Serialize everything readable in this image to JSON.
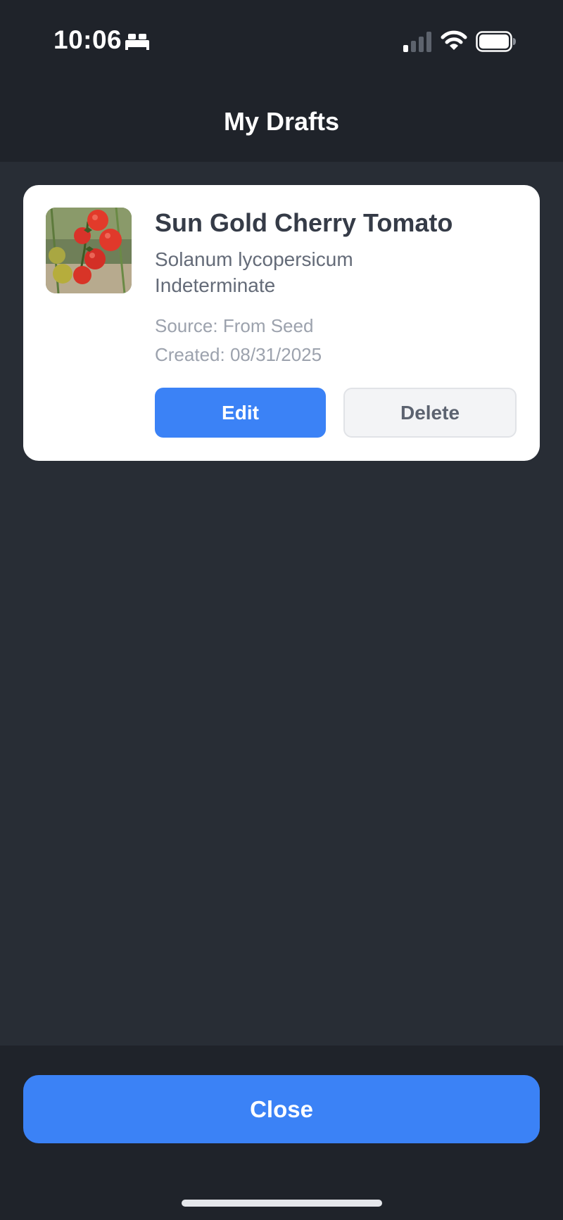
{
  "status_bar": {
    "time": "10:06",
    "icons": [
      "bed-icon",
      "cellular-signal-icon",
      "wifi-icon",
      "battery-icon"
    ]
  },
  "header": {
    "title": "My Drafts"
  },
  "drafts": [
    {
      "name": "Sun Gold Cherry Tomato",
      "scientific_name": "Solanum lycopersicum",
      "growth_type": "Indeterminate",
      "source": "Source: From Seed",
      "created": "Created: 08/31/2025",
      "thumbnail": "tomato-photo",
      "edit_label": "Edit",
      "delete_label": "Delete"
    }
  ],
  "footer": {
    "close_label": "Close"
  },
  "colors": {
    "background": "#282d35",
    "bar_background": "#1f232a",
    "card_background": "#ffffff",
    "primary": "#3b82f6",
    "secondary_button": "#f3f4f6",
    "title_text": "#353b47",
    "muted_text": "#9ca2ad"
  }
}
